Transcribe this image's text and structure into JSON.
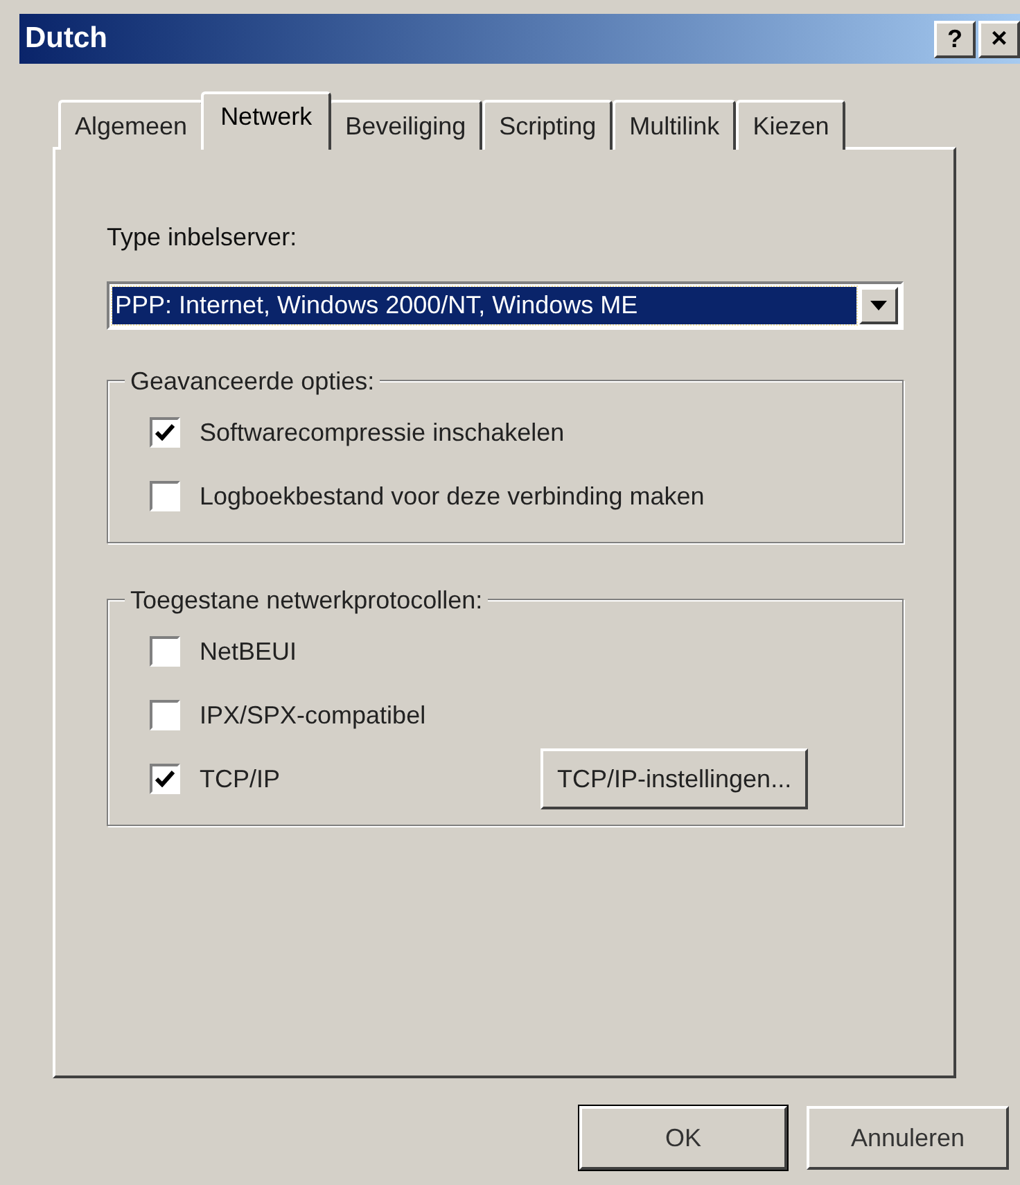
{
  "window": {
    "title": "Dutch",
    "help": "?",
    "close": "×"
  },
  "tabs": [
    {
      "label": "Algemeen",
      "selected": false
    },
    {
      "label": "Netwerk",
      "selected": true
    },
    {
      "label": "Beveiliging",
      "selected": false
    },
    {
      "label": "Scripting",
      "selected": false
    },
    {
      "label": "Multilink",
      "selected": false
    },
    {
      "label": "Kiezen",
      "selected": false
    }
  ],
  "server_type": {
    "label": "Type inbelserver:",
    "value": "PPP: Internet, Windows 2000/NT, Windows ME"
  },
  "groups": [
    {
      "title": "Geavanceerde opties:",
      "items": [
        {
          "kind": "checkbox",
          "label": "Softwarecompressie inschakelen",
          "checked": true
        },
        {
          "kind": "checkbox",
          "label": "Logboekbestand voor deze verbinding maken",
          "checked": false
        }
      ]
    },
    {
      "title": "Toegestane netwerkprotocollen:",
      "items": [
        {
          "kind": "checkbox",
          "label": "NetBEUI",
          "checked": false
        },
        {
          "kind": "checkbox",
          "label": "IPX/SPX-compatibel",
          "checked": false
        },
        {
          "kind": "checkbox",
          "label": "TCP/IP",
          "checked": true,
          "button": "TCP/IP-instellingen..."
        }
      ]
    }
  ],
  "buttons": [
    {
      "label": "OK",
      "default": true
    },
    {
      "label": "Annuleren",
      "default": false
    }
  ]
}
